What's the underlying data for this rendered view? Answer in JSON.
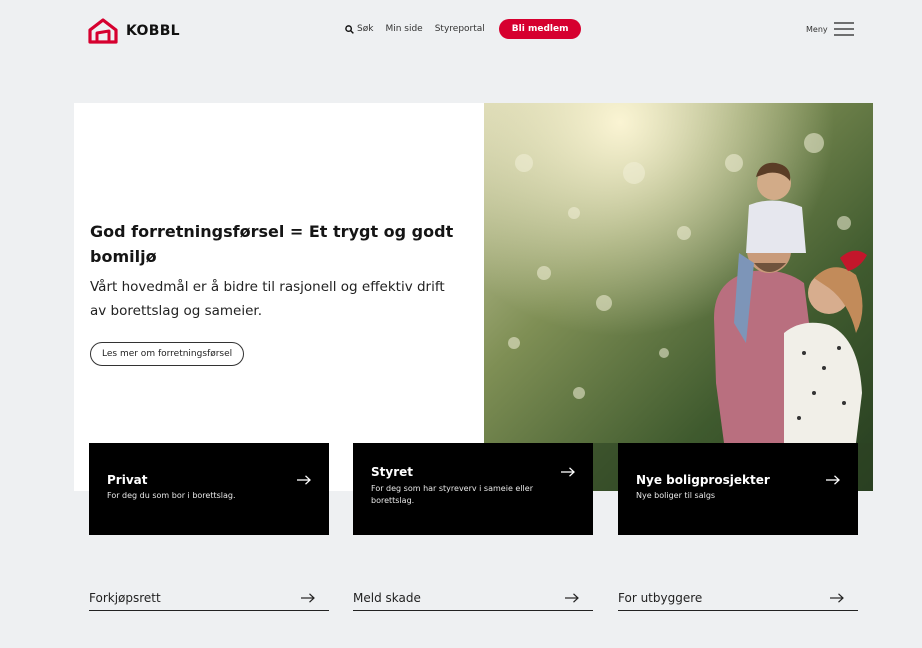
{
  "header": {
    "logo_text": "KOBBL",
    "nav": {
      "search_label": "Søk",
      "my_page_label": "Min side",
      "board_portal_label": "Styreportal",
      "cta_label": "Bli medlem"
    },
    "menu_label": "Meny"
  },
  "hero": {
    "title": "God forretningsførsel = Et trygt og godt bomiljø",
    "subtitle": "Vårt hovedmål er å bidre til rasjonell og effektiv drift av borettslag og sameier.",
    "link_label": "Les mer om forretningsførsel"
  },
  "cards": [
    {
      "title": "Privat",
      "description": "For deg du som bor i borettslag."
    },
    {
      "title": "Styret",
      "description": "For deg som har styreverv i sameie eller borettslag."
    },
    {
      "title": "Nye boligprosjekter",
      "description": "Nye boliger til salgs"
    }
  ],
  "links": [
    {
      "label": "Forkjøpsrett"
    },
    {
      "label": "Meld skade"
    },
    {
      "label": "For utbyggere"
    }
  ],
  "colors": {
    "accent": "#d6002f",
    "card_bg": "#000000",
    "page_bg": "#eef0f2"
  },
  "icons": {
    "logo": "house-logo-icon",
    "search": "search-icon",
    "menu": "hamburger-icon",
    "arrow": "arrow-right-icon"
  }
}
